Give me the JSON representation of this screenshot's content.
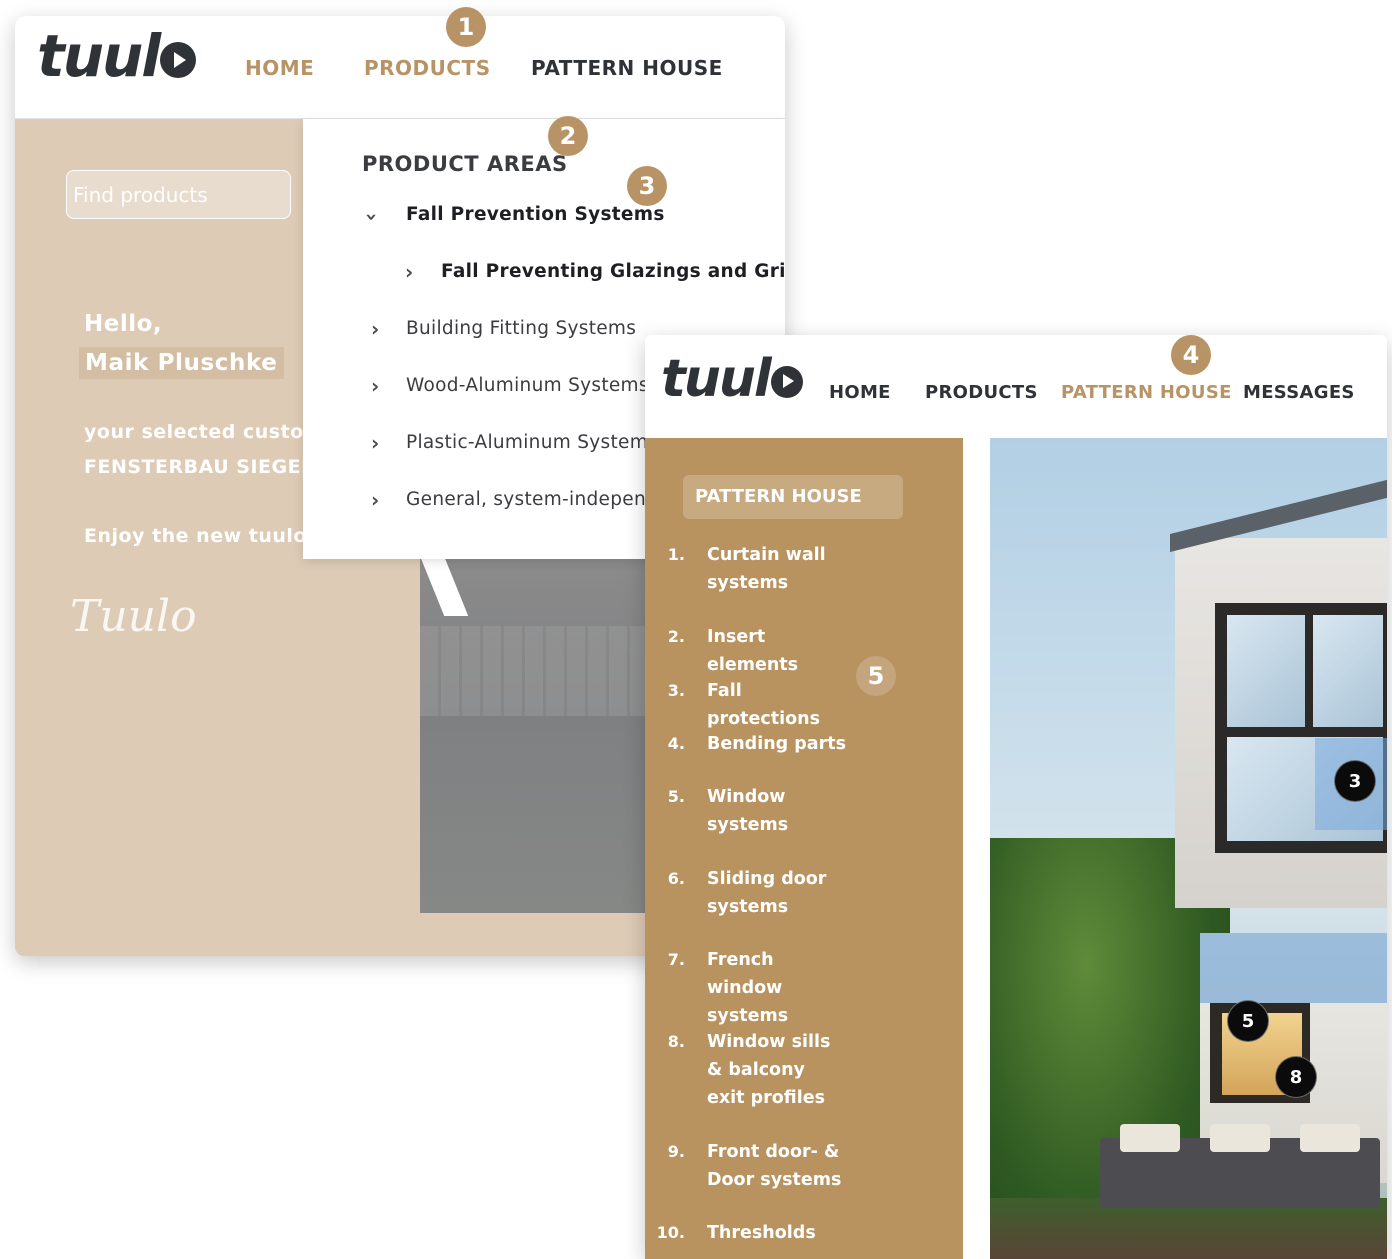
{
  "window1": {
    "logo": "tuul",
    "nav": {
      "home": "HOME",
      "products": "PRODUCTS",
      "pattern_house": "PATTERN HOUSE"
    },
    "search": {
      "placeholder": "Find products"
    },
    "greeting": {
      "hello": "Hello,",
      "name": "Maik Pluschke",
      "selected_customer": "your selected custom",
      "customer_name": "FENSTERBAU SIEGEN",
      "enjoy": "Enjoy the new tuulo a",
      "signature": "Tuulo"
    },
    "dropdown": {
      "title": "PRODUCT AREAS",
      "items": [
        {
          "label": "Fall Prevention Systems",
          "state": "expanded"
        },
        {
          "label": "Fall Preventing Glazings and Grids",
          "state": "child"
        },
        {
          "label": "Building Fitting Systems",
          "state": "collapsed"
        },
        {
          "label": "Wood-Aluminum Systems",
          "state": "collapsed"
        },
        {
          "label": "Plastic-Aluminum Systems",
          "state": "collapsed"
        },
        {
          "label": "General, system-independe",
          "state": "collapsed"
        }
      ]
    }
  },
  "window2": {
    "logo": "tuul",
    "nav": {
      "home": "HOME",
      "products": "PRODUCTS",
      "pattern_house": "PATTERN HOUSE",
      "messages": "MESSAGES"
    },
    "sidebar_title": "PATTERN HOUSE",
    "list": [
      {
        "num": "1.",
        "label": "Curtain wall systems"
      },
      {
        "num": "2.",
        "label": "Insert elements"
      },
      {
        "num": "3.",
        "label": "Fall protections"
      },
      {
        "num": "4.",
        "label": "Bending parts"
      },
      {
        "num": "5.",
        "label": "Window systems"
      },
      {
        "num": "6.",
        "label": "Sliding door systems"
      },
      {
        "num": "7.",
        "label": "French window systems"
      },
      {
        "num": "8.",
        "label": "Window sills & balcony exit profiles"
      },
      {
        "num": "9.",
        "label": "Front door- & Door systems"
      },
      {
        "num": "10.",
        "label": "Thresholds"
      }
    ],
    "hotspots": {
      "a": "3",
      "b": "5",
      "c": "8"
    }
  },
  "badges": {
    "b1": "1",
    "b2": "2",
    "b3": "3",
    "b4": "4",
    "b5": "5"
  },
  "colors": {
    "accent_gold": "#b89366",
    "sidebar_beige": "#ddcbb5",
    "sidebar_brown": "#b8925f",
    "text_dark": "#2f3338"
  }
}
